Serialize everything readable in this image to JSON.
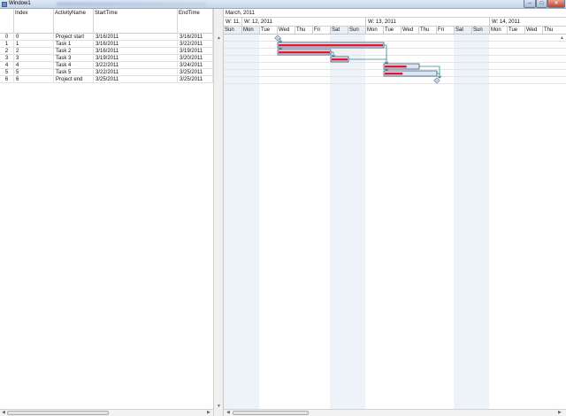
{
  "window": {
    "title": "Window1",
    "controls": {
      "minimize": "–",
      "maximize": "□",
      "close": "✕"
    }
  },
  "grid": {
    "columns": [
      "Index",
      "ActivityName",
      "StartTime",
      "EndTime"
    ],
    "rows": [
      {
        "num": "0",
        "index": "0",
        "name": "Project start",
        "start": "3/16/2011",
        "end": "3/16/2011"
      },
      {
        "num": "1",
        "index": "1",
        "name": "Task 1",
        "start": "3/16/2011",
        "end": "3/22/2011"
      },
      {
        "num": "2",
        "index": "2",
        "name": "Task 2",
        "start": "3/16/2011",
        "end": "3/19/2011"
      },
      {
        "num": "3",
        "index": "3",
        "name": "Task 3",
        "start": "3/19/2011",
        "end": "3/20/2011"
      },
      {
        "num": "4",
        "index": "4",
        "name": "Task 4",
        "start": "3/22/2011",
        "end": "3/24/2011"
      },
      {
        "num": "5",
        "index": "5",
        "name": "Task 5",
        "start": "3/22/2011",
        "end": "3/25/2011"
      },
      {
        "num": "6",
        "index": "6",
        "name": "Project end",
        "start": "3/25/2011",
        "end": "3/25/2011"
      }
    ]
  },
  "timeline": {
    "month": "March, 2011",
    "weeks": [
      "W: 11,",
      "W: 12, 2011",
      "W: 13, 2011",
      "W: 14, 2011"
    ],
    "days": [
      "Sun",
      "Mon",
      "Tue",
      "Wed",
      "Thu",
      "Fri",
      "Sat",
      "Sun",
      "Mon",
      "Tue",
      "Wed",
      "Thu",
      "Fri",
      "Sat",
      "Sun",
      "Mon",
      "Tue",
      "Wed",
      "Thu"
    ],
    "start_day": "3/13/2011"
  },
  "gantt": {
    "tasks": [
      {
        "kind": "milestone",
        "start": "3/16/2011",
        "end": "3/16/2011"
      },
      {
        "kind": "bar",
        "start": "3/16/2011",
        "end": "3/22/2011",
        "progress": 1.0
      },
      {
        "kind": "bar",
        "start": "3/16/2011",
        "end": "3/19/2011",
        "progress": 1.0
      },
      {
        "kind": "bar",
        "start": "3/19/2011",
        "end": "3/20/2011",
        "progress": 1.0
      },
      {
        "kind": "bar",
        "start": "3/22/2011",
        "end": "3/24/2011",
        "progress": 0.65
      },
      {
        "kind": "bar",
        "start": "3/22/2011",
        "end": "3/25/2011",
        "progress": 0.35
      },
      {
        "kind": "milestone",
        "start": "3/25/2011",
        "end": "3/25/2011"
      }
    ],
    "links": [
      [
        0,
        1
      ],
      [
        0,
        2
      ],
      [
        2,
        3
      ],
      [
        1,
        4
      ],
      [
        3,
        4
      ],
      [
        4,
        5
      ],
      [
        4,
        6
      ],
      [
        5,
        6
      ]
    ],
    "colors": {
      "bar_fill": "#d9e6f4",
      "bar_border": "#2f3f6a",
      "progress": "#e0142a",
      "link": "#2a8c8c",
      "milestone": "#c8d4e4",
      "weekend": "#eef3f9"
    }
  }
}
